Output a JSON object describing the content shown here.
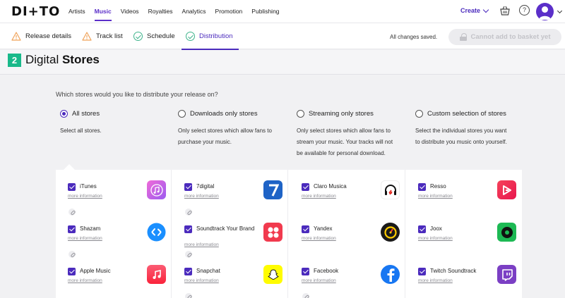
{
  "brand": {
    "logo_text": "DI+TO"
  },
  "nav": {
    "items": [
      {
        "label": "Artists"
      },
      {
        "label": "Music"
      },
      {
        "label": "Videos"
      },
      {
        "label": "Royalties"
      },
      {
        "label": "Analytics"
      },
      {
        "label": "Promotion"
      },
      {
        "label": "Publishing"
      }
    ],
    "active": "Music",
    "create_label": "Create"
  },
  "steps": [
    {
      "label": "Release details",
      "status": "warning"
    },
    {
      "label": "Track list",
      "status": "warning"
    },
    {
      "label": "Schedule",
      "status": "complete"
    },
    {
      "label": "Distribution",
      "status": "complete"
    }
  ],
  "save_status": "All changes saved.",
  "basket_button_label": "Cannot add to basket yet",
  "section": {
    "number": "2",
    "title_light": "Digital ",
    "title_bold": "Stores"
  },
  "question": "Which stores would you like to distribute your release on?",
  "options": [
    {
      "label": "All stores",
      "selected": true,
      "desc_lines": [
        "Select all stores."
      ]
    },
    {
      "label": "Downloads only stores",
      "selected": false,
      "desc_lines": [
        "Only select stores which allow fans to",
        "purchase your music."
      ]
    },
    {
      "label": "Streaming only stores",
      "selected": false,
      "desc_lines": [
        "Only select stores which allow fans to",
        "stream your music. Your tracks will not",
        "be available for personal download."
      ]
    },
    {
      "label": "Custom selection of stores",
      "selected": false,
      "desc_lines": [
        "Select the individual stores you want",
        "to distribute you music onto yourself."
      ]
    }
  ],
  "more_info_label": "more information",
  "stores": [
    [
      {
        "name": "iTunes",
        "checked": true,
        "icon": "itunes-icon",
        "color": "#c86bd8"
      },
      {
        "name": "Shazam",
        "checked": true,
        "icon": "shazam-icon",
        "color": "#1a8fff"
      },
      {
        "name": "Apple Music",
        "checked": true,
        "icon": "apple-music-icon",
        "color": "#f5304b"
      }
    ],
    [
      {
        "name": "7digital",
        "checked": true,
        "icon": "7digital-icon",
        "color": "#1e63c6"
      },
      {
        "name": "Soundtrack Your Brand",
        "checked": true,
        "icon": "soundtrack-icon",
        "color": "#f13a4e"
      },
      {
        "name": "Snapchat",
        "checked": true,
        "icon": "snapchat-icon",
        "color": "#fffc00"
      }
    ],
    [
      {
        "name": "Claro Musica",
        "checked": true,
        "icon": "claro-icon",
        "color": "#ffffff"
      },
      {
        "name": "Yandex",
        "checked": true,
        "icon": "yandex-icon",
        "color": "#1a1a1a"
      },
      {
        "name": "Facebook",
        "checked": true,
        "icon": "facebook-icon",
        "color": "#1877f2"
      }
    ],
    [
      {
        "name": "Resso",
        "checked": true,
        "icon": "resso-icon",
        "color": "#f1325a"
      },
      {
        "name": "Joox",
        "checked": true,
        "icon": "joox-icon",
        "color": "#1db954"
      },
      {
        "name": "Twitch Soundtrack",
        "checked": true,
        "icon": "twitch-icon",
        "color": "#7b3fc4"
      }
    ]
  ]
}
